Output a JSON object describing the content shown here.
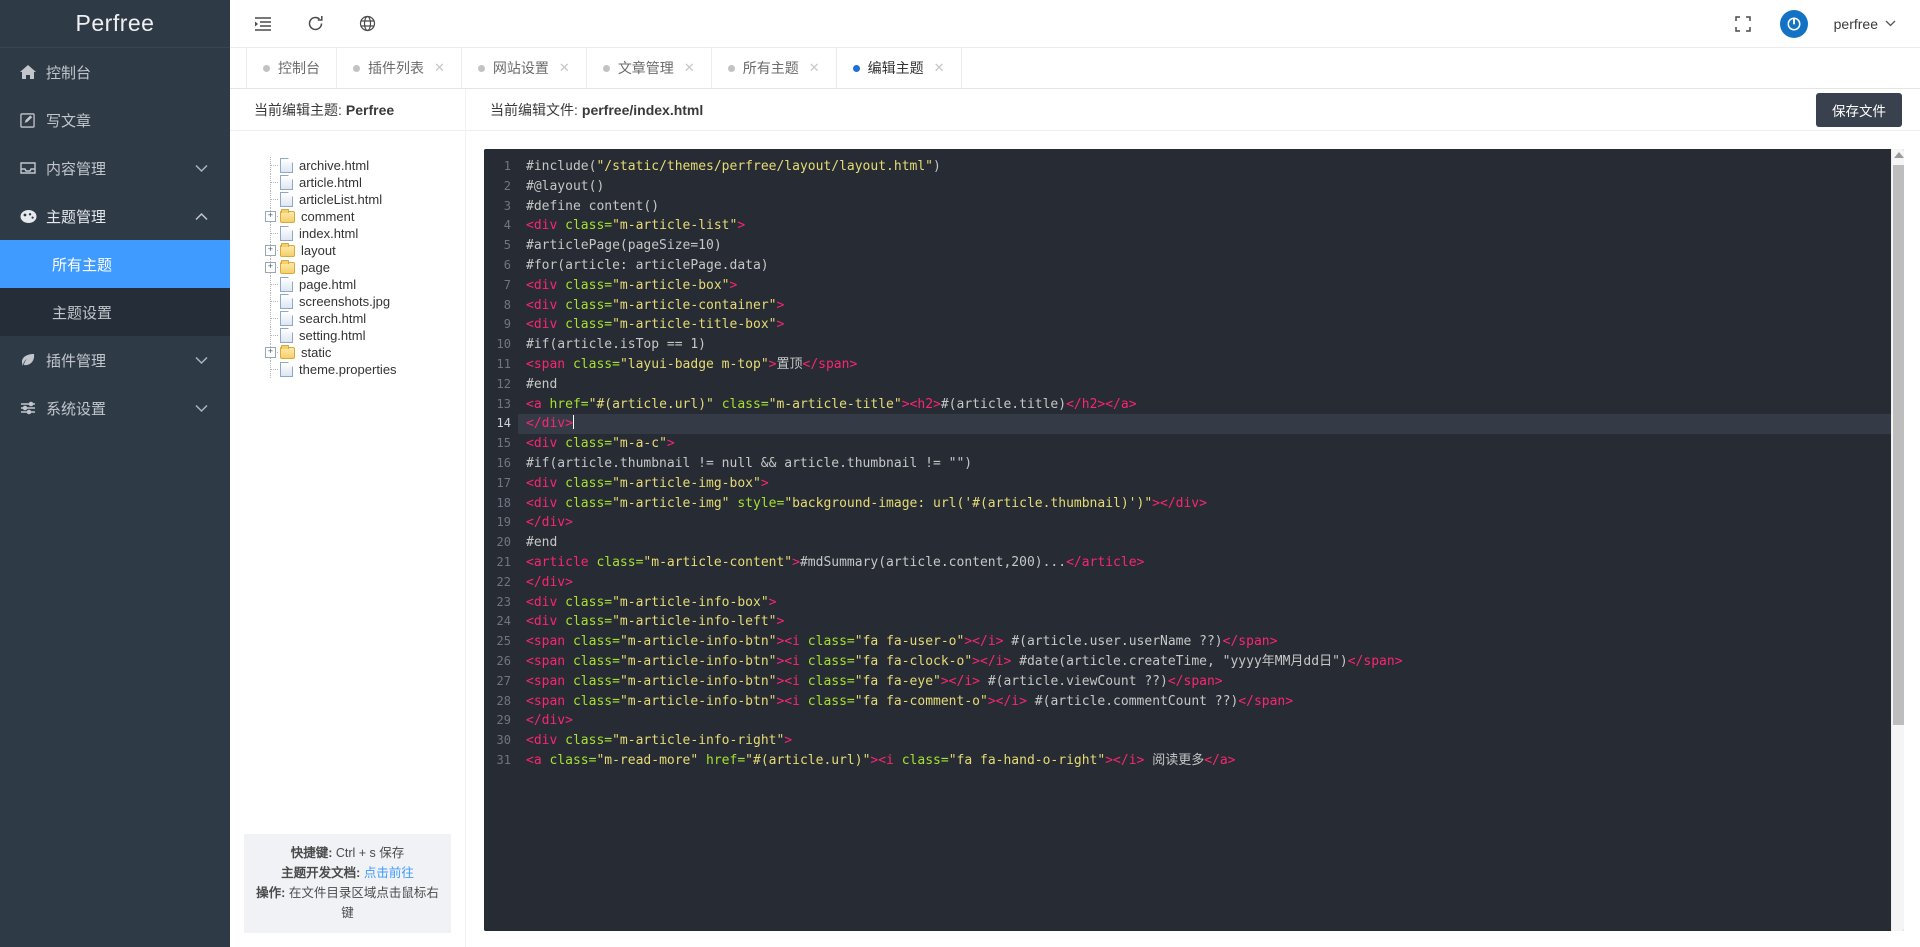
{
  "sidebar": {
    "logo": "Perfree",
    "items": [
      {
        "icon": "home-icon",
        "label": "控制台",
        "arrow": ""
      },
      {
        "icon": "edit-square-icon",
        "label": "写文章",
        "arrow": ""
      },
      {
        "icon": "inbox-icon",
        "label": "内容管理",
        "arrow": "˅"
      },
      {
        "icon": "palette-icon",
        "label": "主题管理",
        "arrow": "˄"
      },
      {
        "icon": "leaf-icon",
        "label": "插件管理",
        "arrow": "˅"
      },
      {
        "icon": "sliders-icon",
        "label": "系统设置",
        "arrow": "˅"
      }
    ],
    "submenu": [
      {
        "label": "所有主题",
        "active": true
      },
      {
        "label": "主题设置",
        "active": false
      }
    ]
  },
  "topbar": {
    "icons": [
      "menu-fold-icon",
      "refresh-icon",
      "globe-icon"
    ],
    "fullscreen_icon": "fullscreen-icon",
    "user": "perfree",
    "user_caret": "˅"
  },
  "tabs": [
    {
      "label": "控制台",
      "closable": false,
      "active": false
    },
    {
      "label": "插件列表",
      "closable": true,
      "active": false
    },
    {
      "label": "网站设置",
      "closable": true,
      "active": false
    },
    {
      "label": "文章管理",
      "closable": true,
      "active": false
    },
    {
      "label": "所有主题",
      "closable": true,
      "active": false
    },
    {
      "label": "编辑主题",
      "closable": true,
      "active": true
    }
  ],
  "file_panel": {
    "header_label": "当前编辑主题:",
    "header_value": "Perfree",
    "tree": [
      {
        "type": "file",
        "name": "archive.html",
        "expandable": false
      },
      {
        "type": "file",
        "name": "article.html",
        "expandable": false
      },
      {
        "type": "file",
        "name": "articleList.html",
        "expandable": false
      },
      {
        "type": "folder",
        "name": "comment",
        "expandable": true
      },
      {
        "type": "file",
        "name": "index.html",
        "expandable": false
      },
      {
        "type": "folder",
        "name": "layout",
        "expandable": true
      },
      {
        "type": "folder",
        "name": "page",
        "expandable": true
      },
      {
        "type": "file",
        "name": "page.html",
        "expandable": false
      },
      {
        "type": "file",
        "name": "screenshots.jpg",
        "expandable": false
      },
      {
        "type": "file",
        "name": "search.html",
        "expandable": false
      },
      {
        "type": "file",
        "name": "setting.html",
        "expandable": false
      },
      {
        "type": "folder",
        "name": "static",
        "expandable": true
      },
      {
        "type": "file",
        "name": "theme.properties",
        "expandable": false
      }
    ],
    "footer": {
      "shortcut_label": "快捷键:",
      "shortcut_value": "Ctrl + s 保存",
      "doc_label": "主题开发文档:",
      "doc_link": "点击前往",
      "op_label": "操作:",
      "op_value": "在文件目录区域点击鼠标右键"
    }
  },
  "editor": {
    "header_label": "当前编辑文件:",
    "header_value": "perfree/index.html",
    "save_label": "保存文件",
    "active_line": 14,
    "line_count": 31,
    "lines": [
      {
        "n": 1,
        "tokens": [
          {
            "t": "#include(",
            "c": "plain"
          },
          {
            "t": "\"/static/themes/perfree/layout/layout.html\"",
            "c": "str"
          },
          {
            "t": ")",
            "c": "plain"
          }
        ]
      },
      {
        "n": 2,
        "tokens": [
          {
            "t": "#@layout()",
            "c": "plain"
          }
        ]
      },
      {
        "n": 3,
        "tokens": [
          {
            "t": "#define content()",
            "c": "plain"
          }
        ]
      },
      {
        "n": 4,
        "tokens": [
          {
            "t": "    <div ",
            "c": "tag"
          },
          {
            "t": "class=",
            "c": "attr"
          },
          {
            "t": "\"m-article-list\"",
            "c": "str"
          },
          {
            "t": ">",
            "c": "tag"
          }
        ]
      },
      {
        "n": 5,
        "tokens": [
          {
            "t": "        #articlePage(pageSize=10)",
            "c": "plain"
          }
        ]
      },
      {
        "n": 6,
        "tokens": [
          {
            "t": "            #for(article: articlePage.data)",
            "c": "plain"
          }
        ]
      },
      {
        "n": 7,
        "tokens": [
          {
            "t": "                <div ",
            "c": "tag"
          },
          {
            "t": "class=",
            "c": "attr"
          },
          {
            "t": "\"m-article-box\"",
            "c": "str"
          },
          {
            "t": ">",
            "c": "tag"
          }
        ]
      },
      {
        "n": 8,
        "tokens": [
          {
            "t": "                    <div ",
            "c": "tag"
          },
          {
            "t": "class=",
            "c": "attr"
          },
          {
            "t": "\"m-article-container\"",
            "c": "str"
          },
          {
            "t": ">",
            "c": "tag"
          }
        ]
      },
      {
        "n": 9,
        "tokens": [
          {
            "t": "                        <div ",
            "c": "tag"
          },
          {
            "t": "class=",
            "c": "attr"
          },
          {
            "t": "\"m-article-title-box\"",
            "c": "str"
          },
          {
            "t": ">",
            "c": "tag"
          }
        ]
      },
      {
        "n": 10,
        "tokens": [
          {
            "t": "                            #if(article.isTop == 1)",
            "c": "plain"
          }
        ]
      },
      {
        "n": 11,
        "tokens": [
          {
            "t": "                                <span ",
            "c": "tag"
          },
          {
            "t": "class=",
            "c": "attr"
          },
          {
            "t": "\"layui-badge m-top\"",
            "c": "str"
          },
          {
            "t": ">",
            "c": "tag"
          },
          {
            "t": "置顶",
            "c": "plain"
          },
          {
            "t": "</span>",
            "c": "tag"
          }
        ]
      },
      {
        "n": 12,
        "tokens": [
          {
            "t": "                            #end",
            "c": "plain"
          }
        ]
      },
      {
        "n": 13,
        "tokens": [
          {
            "t": "                            <a ",
            "c": "tag"
          },
          {
            "t": "href=",
            "c": "attr"
          },
          {
            "t": "\"#(article.url)\"",
            "c": "str"
          },
          {
            "t": " ",
            "c": "plain"
          },
          {
            "t": "class=",
            "c": "attr"
          },
          {
            "t": "\"m-article-title\"",
            "c": "str"
          },
          {
            "t": ">",
            "c": "tag"
          },
          {
            "t": "<h2>",
            "c": "tag"
          },
          {
            "t": "#(article.title)",
            "c": "plain"
          },
          {
            "t": "</h2></a>",
            "c": "tag"
          }
        ]
      },
      {
        "n": 14,
        "tokens": [
          {
            "t": "                        </div>",
            "c": "tag"
          }
        ]
      },
      {
        "n": 15,
        "tokens": [
          {
            "t": "                        <div ",
            "c": "tag"
          },
          {
            "t": "class=",
            "c": "attr"
          },
          {
            "t": "\"m-a-c\"",
            "c": "str"
          },
          {
            "t": ">",
            "c": "tag"
          }
        ]
      },
      {
        "n": 16,
        "tokens": [
          {
            "t": "                            #if(article.thumbnail != null && article.thumbnail != \"\")",
            "c": "plain"
          }
        ]
      },
      {
        "n": 17,
        "tokens": [
          {
            "t": "                                <div ",
            "c": "tag"
          },
          {
            "t": "class=",
            "c": "attr"
          },
          {
            "t": "\"m-article-img-box\"",
            "c": "str"
          },
          {
            "t": ">",
            "c": "tag"
          }
        ]
      },
      {
        "n": 18,
        "tokens": [
          {
            "t": "                                    <div ",
            "c": "tag"
          },
          {
            "t": "class=",
            "c": "attr"
          },
          {
            "t": "\"m-article-img\"",
            "c": "str"
          },
          {
            "t": " ",
            "c": "plain"
          },
          {
            "t": "style=",
            "c": "attr"
          },
          {
            "t": "\"background-image: url('#(article.thumbnail)')\"",
            "c": "str"
          },
          {
            "t": "></div>",
            "c": "tag"
          }
        ]
      },
      {
        "n": 19,
        "tokens": [
          {
            "t": "                                </div>",
            "c": "tag"
          }
        ]
      },
      {
        "n": 20,
        "tokens": [
          {
            "t": "                            #end",
            "c": "plain"
          }
        ]
      },
      {
        "n": 21,
        "tokens": [
          {
            "t": "                            <article ",
            "c": "tag"
          },
          {
            "t": "class=",
            "c": "attr"
          },
          {
            "t": "\"m-article-content\"",
            "c": "str"
          },
          {
            "t": ">",
            "c": "tag"
          },
          {
            "t": "#mdSummary(article.content,200)...",
            "c": "plain"
          },
          {
            "t": "</article>",
            "c": "tag"
          }
        ]
      },
      {
        "n": 22,
        "tokens": [
          {
            "t": "                        </div>",
            "c": "tag"
          }
        ]
      },
      {
        "n": 23,
        "tokens": [
          {
            "t": "                        <div ",
            "c": "tag"
          },
          {
            "t": "class=",
            "c": "attr"
          },
          {
            "t": "\"m-article-info-box\"",
            "c": "str"
          },
          {
            "t": ">",
            "c": "tag"
          }
        ]
      },
      {
        "n": 24,
        "tokens": [
          {
            "t": "                            <div ",
            "c": "tag"
          },
          {
            "t": "class=",
            "c": "attr"
          },
          {
            "t": "\"m-article-info-left\"",
            "c": "str"
          },
          {
            "t": ">",
            "c": "tag"
          }
        ]
      },
      {
        "n": 25,
        "tokens": [
          {
            "t": "                                <span ",
            "c": "tag"
          },
          {
            "t": "class=",
            "c": "attr"
          },
          {
            "t": "\"m-article-info-btn\"",
            "c": "str"
          },
          {
            "t": "><i ",
            "c": "tag"
          },
          {
            "t": "class=",
            "c": "attr"
          },
          {
            "t": "\"fa fa-user-o\"",
            "c": "str"
          },
          {
            "t": "></i>",
            "c": "tag"
          },
          {
            "t": " #(article.user.userName ??)",
            "c": "plain"
          },
          {
            "t": "</span>",
            "c": "tag"
          }
        ]
      },
      {
        "n": 26,
        "tokens": [
          {
            "t": "                                <span ",
            "c": "tag"
          },
          {
            "t": "class=",
            "c": "attr"
          },
          {
            "t": "\"m-article-info-btn\"",
            "c": "str"
          },
          {
            "t": "><i ",
            "c": "tag"
          },
          {
            "t": "class=",
            "c": "attr"
          },
          {
            "t": "\"fa fa-clock-o\"",
            "c": "str"
          },
          {
            "t": "></i>",
            "c": "tag"
          },
          {
            "t": " #date(article.createTime, \"yyyy年MM月dd日\")",
            "c": "plain"
          },
          {
            "t": "</span>",
            "c": "tag"
          }
        ]
      },
      {
        "n": 27,
        "tokens": [
          {
            "t": "                                <span ",
            "c": "tag"
          },
          {
            "t": "class=",
            "c": "attr"
          },
          {
            "t": "\"m-article-info-btn\"",
            "c": "str"
          },
          {
            "t": "><i ",
            "c": "tag"
          },
          {
            "t": "class=",
            "c": "attr"
          },
          {
            "t": "\"fa fa-eye\"",
            "c": "str"
          },
          {
            "t": "></i>",
            "c": "tag"
          },
          {
            "t": " #(article.viewCount ??)",
            "c": "plain"
          },
          {
            "t": "</span>",
            "c": "tag"
          }
        ]
      },
      {
        "n": 28,
        "tokens": [
          {
            "t": "                                <span ",
            "c": "tag"
          },
          {
            "t": "class=",
            "c": "attr"
          },
          {
            "t": "\"m-article-info-btn\"",
            "c": "str"
          },
          {
            "t": "><i ",
            "c": "tag"
          },
          {
            "t": "class=",
            "c": "attr"
          },
          {
            "t": "\"fa fa-comment-o\"",
            "c": "str"
          },
          {
            "t": "></i>",
            "c": "tag"
          },
          {
            "t": " #(article.commentCount ??)",
            "c": "plain"
          },
          {
            "t": "</span>",
            "c": "tag"
          }
        ]
      },
      {
        "n": 29,
        "tokens": [
          {
            "t": "                            </div>",
            "c": "tag"
          }
        ]
      },
      {
        "n": 30,
        "tokens": [
          {
            "t": "                            <div ",
            "c": "tag"
          },
          {
            "t": "class=",
            "c": "attr"
          },
          {
            "t": "\"m-article-info-right\"",
            "c": "str"
          },
          {
            "t": ">",
            "c": "tag"
          }
        ]
      },
      {
        "n": 31,
        "tokens": [
          {
            "t": "                                <a ",
            "c": "tag"
          },
          {
            "t": "class=",
            "c": "attr"
          },
          {
            "t": "\"m-read-more\"",
            "c": "str"
          },
          {
            "t": " ",
            "c": "plain"
          },
          {
            "t": "href=",
            "c": "attr"
          },
          {
            "t": "\"#(article.url)\"",
            "c": "str"
          },
          {
            "t": "><i ",
            "c": "tag"
          },
          {
            "t": "class=",
            "c": "attr"
          },
          {
            "t": "\"fa fa-hand-o-right\"",
            "c": "str"
          },
          {
            "t": "></i>",
            "c": "tag"
          },
          {
            "t": " 阅读更多",
            "c": "plain"
          },
          {
            "t": "</a>",
            "c": "tag"
          }
        ]
      }
    ]
  },
  "colors": {
    "sidebar_bg": "#2f3a47",
    "submenu_bg": "#252d38",
    "accent": "#3f9bff",
    "editor_bg": "#272b33",
    "active_line": "#343b47",
    "save_btn": "#39414f"
  }
}
